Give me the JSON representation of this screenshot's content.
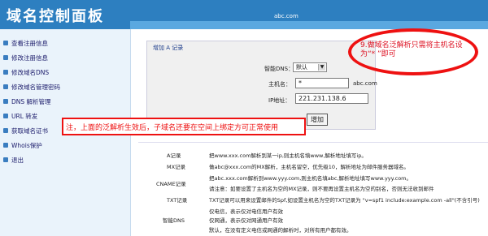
{
  "header": {
    "title": "域名控制面板",
    "domain": "abc.com"
  },
  "sidebar": {
    "items": [
      {
        "label": "查看注册信息"
      },
      {
        "label": "修改注册信息"
      },
      {
        "label": "修改域名DNS"
      },
      {
        "label": "修改域名管理密码"
      },
      {
        "label": "DNS 解析管理"
      },
      {
        "label": "URL 转发"
      },
      {
        "label": "获取域名证书"
      },
      {
        "label": "Whois保护"
      },
      {
        "label": "退出"
      }
    ]
  },
  "form": {
    "title": "增加 A 记录",
    "smart_dns_label": "智能DNS：",
    "smart_dns_value": "默认",
    "host_label": "主机名：",
    "host_value": "*",
    "host_suffix": "abc.com",
    "ip_label": "IP地址：",
    "ip_value": "221.231.138.6",
    "add_button": "增加"
  },
  "annotations": {
    "oval_text": "9.做域名泛解析只需将主机名设为“* ”即可",
    "notice_text": "注，上面的泛解析生效后，子域名还要在空间上绑定方可正常使用"
  },
  "descriptions": [
    {
      "key": "A记录",
      "text": "把www.xxx.com解析到某一ip,则主机名填www,解析地址填写ip。"
    },
    {
      "key": "MX记录",
      "text": "做abc@xxx.com的MX解析，主机名留空，优先级10，解析地址为邮件服务器域名。"
    },
    {
      "key": "CNAME记录",
      "text": "把abc.xxx.com解析到www.yyy.com,则主机名填abc,解析地址填写www.yyy.com。"
    },
    {
      "key": "",
      "text": "请注意：如要设置了主机名为空的MX记录，则不要再设置主机名为空的别名，否则无法收到邮件"
    },
    {
      "key": "TXT记录",
      "text": "TXT记录可以用来设置邮件的Spf,如设置主机名为空的TXT记录为 \"v=spf1 include:example.com -all\"(不含引号)"
    },
    {
      "key": "",
      "text": "仅电信，表示仅对电信用户有效"
    },
    {
      "key": "智能DNS",
      "text": "仅网通，表示仅对网通用户有效"
    },
    {
      "key": "",
      "text": "默认，在没有定义电信或网通的解析时，对所有用户都有效。"
    }
  ]
}
